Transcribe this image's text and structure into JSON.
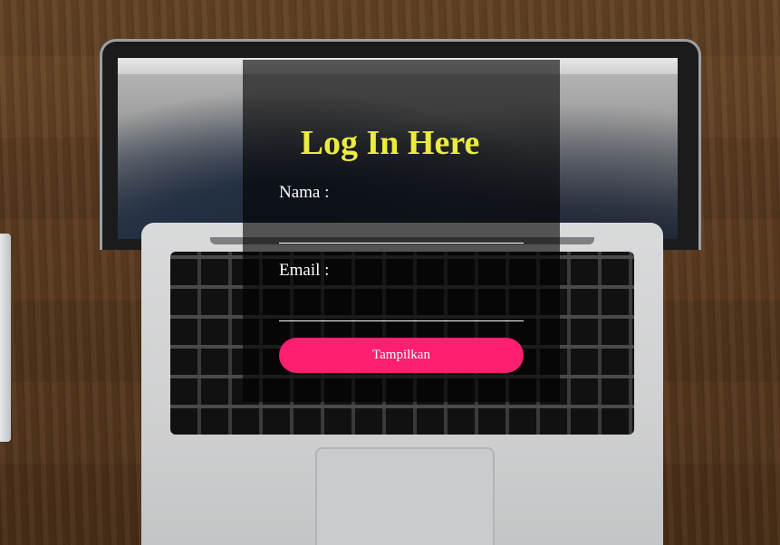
{
  "login": {
    "title": "Log In Here",
    "name_label": "Nama :",
    "name_value": "",
    "email_label": "Email :",
    "email_value": "",
    "submit_label": "Tampilkan"
  },
  "colors": {
    "title": "#ecec3f",
    "button": "#ff1f71",
    "panel_overlay": "rgba(0,0,0,0.62)"
  }
}
